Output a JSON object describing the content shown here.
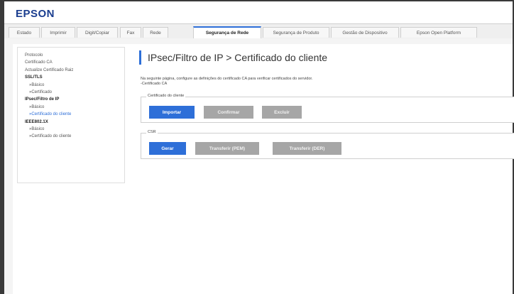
{
  "app": {
    "logo": "EPSON"
  },
  "tabs": [
    {
      "label": "Estado",
      "active": false
    },
    {
      "label": "Imprimir",
      "active": false
    },
    {
      "label": "Digit/Copiar",
      "active": false
    },
    {
      "label": "Fax",
      "active": false
    },
    {
      "label": "Rede",
      "active": false
    },
    {
      "label": "Segurança de Rede",
      "active": true
    },
    {
      "label": "Segurança de Produto",
      "active": false
    },
    {
      "label": "Gestão de Dispositivo",
      "active": false
    },
    {
      "label": "Epson Open Platform",
      "active": false
    }
  ],
  "sidebar": {
    "items": [
      {
        "label": "Protocolo",
        "style": "normal"
      },
      {
        "label": "Certificado CA",
        "style": "normal"
      },
      {
        "label": "Actualize Certificado Raiz",
        "style": "normal"
      },
      {
        "label": "SSL/TLS",
        "style": "bold"
      },
      {
        "label": "»Básico",
        "style": "sub"
      },
      {
        "label": "»Certificado",
        "style": "sub"
      },
      {
        "label": "IPsec/Filtro de IP",
        "style": "bold"
      },
      {
        "label": "»Básico",
        "style": "sub"
      },
      {
        "label": "»Certificado do cliente",
        "style": "current"
      },
      {
        "label": "IEEE802.1X",
        "style": "bold"
      },
      {
        "label": "»Básico",
        "style": "sub"
      },
      {
        "label": "»Certificado do cliente",
        "style": "sub"
      }
    ]
  },
  "main": {
    "title": "IPsec/Filtro de IP > Certificado do cliente",
    "description_line1": "Na seguinte página, configure as definições do certificado CA para verificar certificados do servidor.",
    "description_line2": "-Certificado CA",
    "client_cert_group": {
      "legend": "Certificado do cliente",
      "import_label": "Importar",
      "confirm_label": "Confirmar",
      "delete_label": "Excluir"
    },
    "csr_group": {
      "legend": "CSR",
      "generate_label": "Gerar",
      "download_pem_label": "Transferir (PEM)",
      "download_der_label": "Transferir (DER)"
    }
  },
  "colors": {
    "accent": "#2e6fd8",
    "disabled": "#a6a6a6",
    "brand": "#1a3d8f"
  }
}
